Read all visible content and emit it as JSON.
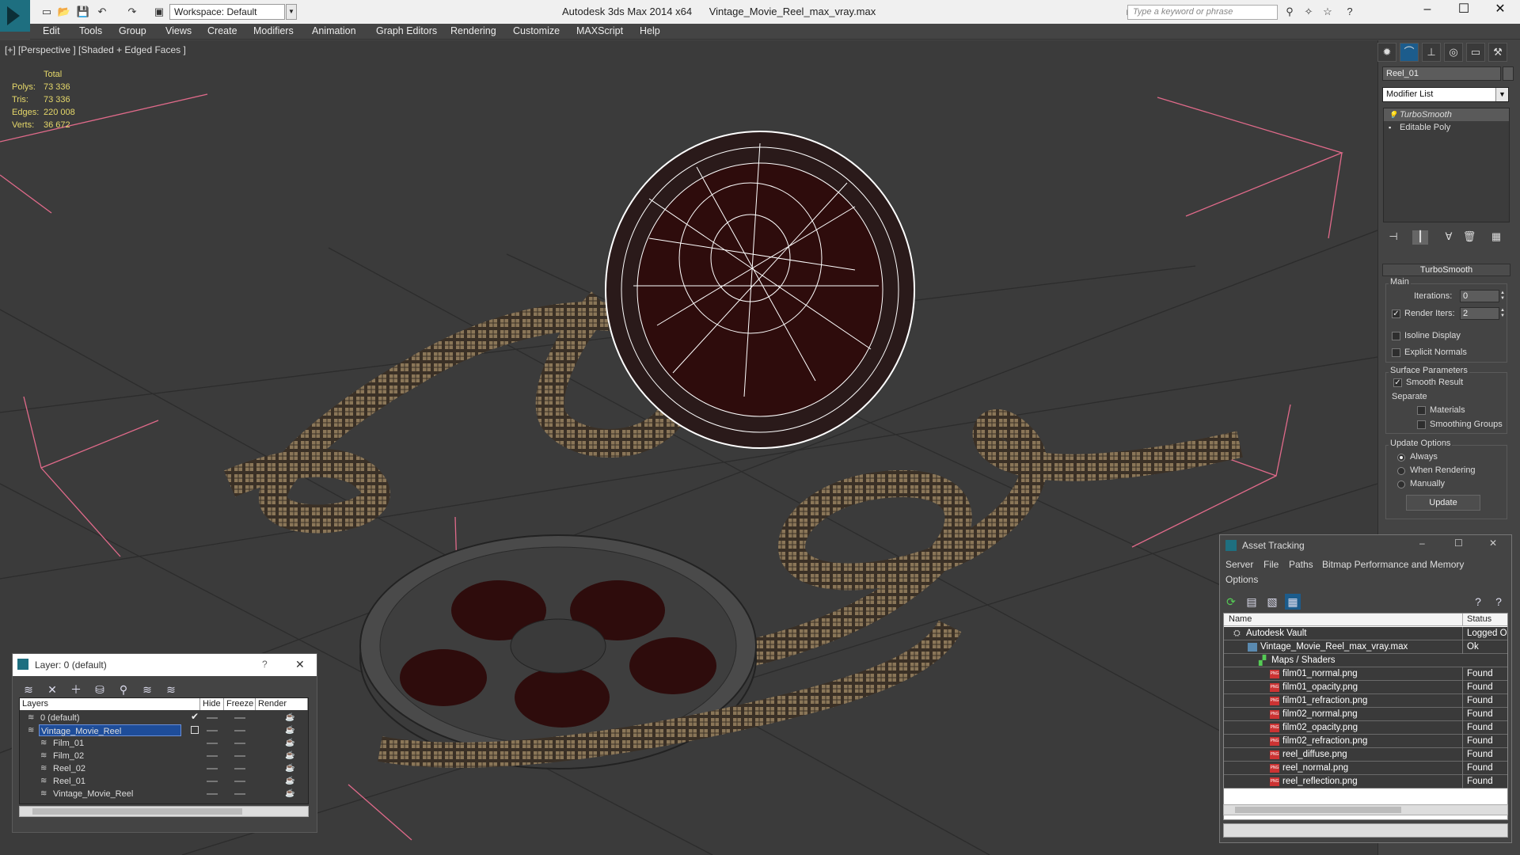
{
  "window": {
    "title": "Autodesk 3ds Max 2014 x64      Vintage_Movie_Reel_max_vray.max",
    "workspace": "Workspace: Default",
    "search_placeholder": "Type a keyword or phrase",
    "minimize": "–",
    "maximize": "☐",
    "close": "✕"
  },
  "menu": [
    "Edit",
    "Tools",
    "Group",
    "Views",
    "Create",
    "Modifiers",
    "Animation",
    "Graph Editors",
    "Rendering",
    "Customize",
    "MAXScript",
    "Help"
  ],
  "viewport": {
    "label": "[+] [Perspective ] [Shaded + Edged Faces ]",
    "stats": {
      "header": "Total",
      "rows": [
        {
          "k": "Polys:",
          "v": "73 336"
        },
        {
          "k": "Tris:",
          "v": "73 336"
        },
        {
          "k": "Edges:",
          "v": "220 008"
        },
        {
          "k": "Verts:",
          "v": "36 672"
        }
      ]
    }
  },
  "command_panel": {
    "object_name": "Reel_01",
    "modifier_list": "Modifier List",
    "stack": [
      "TurboSmooth",
      "Editable Poly"
    ],
    "rollout": "TurboSmooth",
    "main_label": "Main",
    "iterations_label": "Iterations:",
    "iterations_value": "0",
    "render_iters_label": "Render Iters:",
    "render_iters_value": "2",
    "render_iters_checked": "✓",
    "isoline": "Isoline Display",
    "explicit_normals": "Explicit Normals",
    "surface_params": "Surface Parameters",
    "smooth_result": "Smooth Result",
    "smooth_result_checked": "✓",
    "separate": "Separate",
    "materials": "Materials",
    "smoothing_groups": "Smoothing Groups",
    "update_options": "Update Options",
    "always": "Always",
    "when_rendering": "When Rendering",
    "manually": "Manually",
    "update_button": "Update"
  },
  "layer_dialog": {
    "title": "Layer: 0 (default)",
    "help": "?",
    "close": "✕",
    "columns": [
      "Layers",
      "Hide",
      "Freeze",
      "Render"
    ],
    "rows": [
      {
        "name": "0 (default)",
        "indent": 0,
        "selected": false
      },
      {
        "name": "Vintage_Movie_Reel",
        "indent": 0,
        "selected": true
      },
      {
        "name": "Film_01",
        "indent": 1,
        "selected": false
      },
      {
        "name": "Film_02",
        "indent": 1,
        "selected": false
      },
      {
        "name": "Reel_02",
        "indent": 1,
        "selected": false
      },
      {
        "name": "Reel_01",
        "indent": 1,
        "selected": false
      },
      {
        "name": "Vintage_Movie_Reel",
        "indent": 1,
        "selected": false
      }
    ],
    "active_check": "✔"
  },
  "asset_tracking": {
    "title": "Asset Tracking",
    "menu": [
      "Server",
      "File",
      "Paths",
      "Bitmap Performance and Memory",
      "Options"
    ],
    "columns": [
      "Name",
      "Status"
    ],
    "rows": [
      {
        "name": "Autodesk Vault",
        "status": "Logged Out",
        "level": 0,
        "icon": "vault"
      },
      {
        "name": "Vintage_Movie_Reel_max_vray.max",
        "status": "Ok",
        "level": 1,
        "icon": "max"
      },
      {
        "name": "Maps / Shaders",
        "status": "",
        "level": 2,
        "icon": "maps"
      },
      {
        "name": "film01_normal.png",
        "status": "Found",
        "level": 3,
        "icon": "png"
      },
      {
        "name": "film01_opacity.png",
        "status": "Found",
        "level": 3,
        "icon": "png"
      },
      {
        "name": "film01_refraction.png",
        "status": "Found",
        "level": 3,
        "icon": "png"
      },
      {
        "name": "film02_normal.png",
        "status": "Found",
        "level": 3,
        "icon": "png"
      },
      {
        "name": "film02_opacity.png",
        "status": "Found",
        "level": 3,
        "icon": "png"
      },
      {
        "name": "film02_refraction.png",
        "status": "Found",
        "level": 3,
        "icon": "png"
      },
      {
        "name": "reel_diffuse.png",
        "status": "Found",
        "level": 3,
        "icon": "png"
      },
      {
        "name": "reel_normal.png",
        "status": "Found",
        "level": 3,
        "icon": "png"
      },
      {
        "name": "reel_reflection.png",
        "status": "Found",
        "level": 3,
        "icon": "png"
      }
    ],
    "png_icon_text": "PNG"
  }
}
